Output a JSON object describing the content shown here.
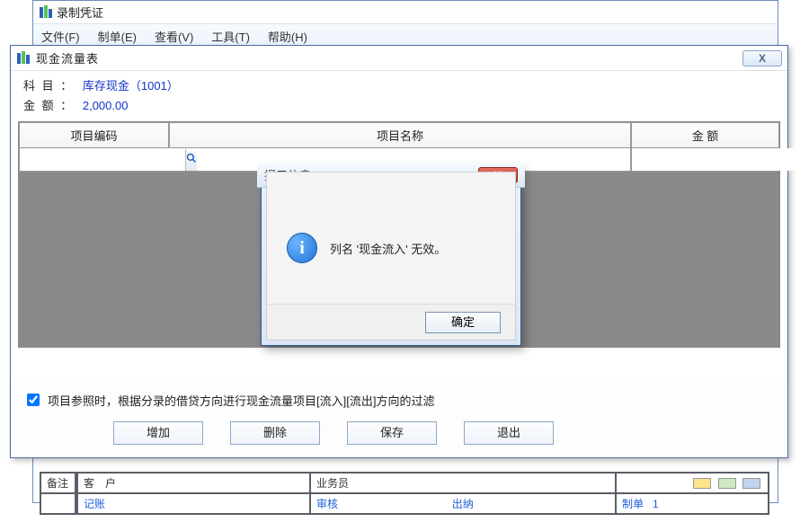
{
  "parent": {
    "title": "录制凭证",
    "menu": [
      "文件(F)",
      "制单(E)",
      "查看(V)",
      "工具(T)",
      "帮助(H)"
    ],
    "bottom": {
      "row1_label": "备注",
      "row1_c1": "客　户",
      "row1_c2": "业务员",
      "row2_c1": "记账",
      "row2_c2": "审核",
      "row2_c3": "出纳",
      "row2_c4": "制单",
      "row2_c5": "1"
    }
  },
  "dlg": {
    "title": "现金流量表",
    "subject_label": "科 目 ：",
    "subject_value": "库存现金（1001）",
    "amount_label": "金 额 ：",
    "amount_value": "2,000.00",
    "columns": {
      "code": "项目编码",
      "name": "项目名称",
      "amount": "金  额"
    },
    "row1_code": "",
    "checkbox_label": "项目参照时，根据分录的借贷方向进行现金流量项目[流入][流出]方向的过滤",
    "buttons": {
      "add": "增加",
      "del": "删除",
      "save": "保存",
      "exit": "退出"
    },
    "close_x": "X"
  },
  "msg": {
    "title": "提示信息",
    "text": "列名 '现金流入' 无效。",
    "ok": "确定",
    "close_x": "X"
  }
}
